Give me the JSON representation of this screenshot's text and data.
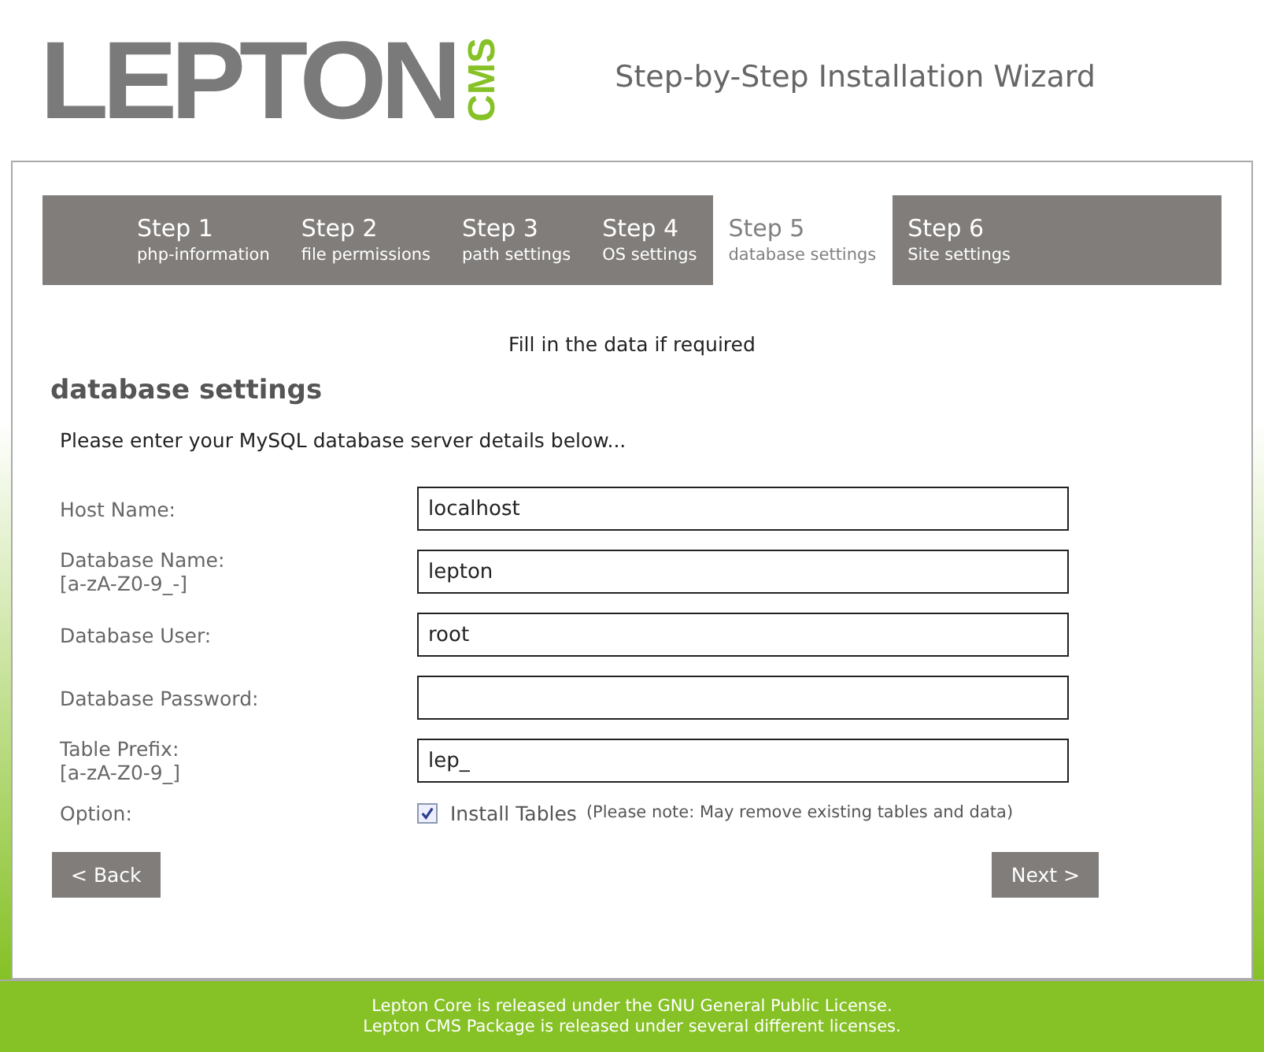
{
  "logo": {
    "main": "LEPTON",
    "side": "CMS"
  },
  "title": "Step-by-Step Installation Wizard",
  "steps": [
    {
      "label": "Step 1",
      "sub": "php-information",
      "selected": false
    },
    {
      "label": "Step 2",
      "sub": "file permissions",
      "selected": false
    },
    {
      "label": "Step 3",
      "sub": "path settings",
      "selected": false
    },
    {
      "label": "Step 4",
      "sub": "OS settings",
      "selected": false
    },
    {
      "label": "Step 5",
      "sub": "database settings",
      "selected": true
    },
    {
      "label": "Step 6",
      "sub": "Site settings",
      "selected": false
    }
  ],
  "notice": "Fill in the data if required",
  "heading": "database settings",
  "intro": "Please enter your MySQL database server details below...",
  "fields": [
    {
      "label": "Host Name:",
      "value": "localhost"
    },
    {
      "label": "Database Name:",
      "hint": "[a-zA-Z0-9_-]",
      "value": "lepton"
    },
    {
      "label": "Database User:",
      "value": "root"
    },
    {
      "label": "Database Password:"
    },
    {
      "label": "Table Prefix:",
      "hint": "[a-zA-Z0-9_]",
      "value": "lep_"
    }
  ],
  "option": {
    "label": "Option:",
    "checked": true,
    "text": "Install Tables",
    "note": "(Please note: May remove existing tables and data)"
  },
  "buttons": {
    "back": "< Back",
    "next": "Next >"
  },
  "footer": [
    "Lepton Core is released under the GNU General Public License.",
    "Lepton CMS Package is released under several different licenses."
  ]
}
